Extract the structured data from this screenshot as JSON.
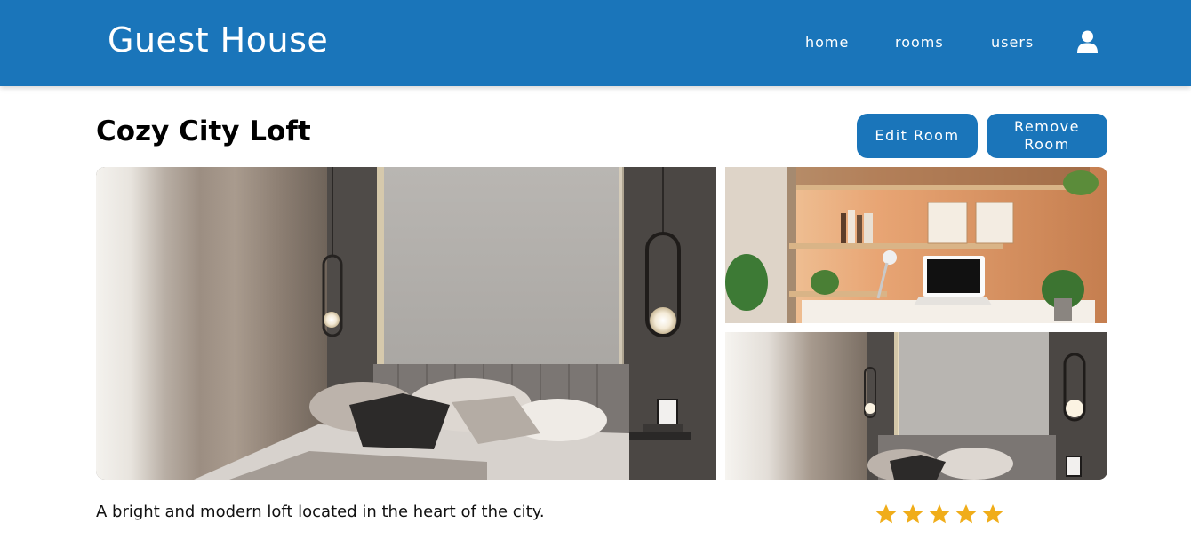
{
  "header": {
    "brand": "Guest House",
    "nav": [
      {
        "label": "home"
      },
      {
        "label": "rooms"
      },
      {
        "label": "users"
      }
    ],
    "user_icon": "user-icon"
  },
  "room": {
    "title": "Cozy City Loft",
    "edit_label": "Edit Room",
    "remove_label": "Remove Room",
    "description": "A bright and modern loft located in the heart of the city.",
    "rating": 5,
    "rating_max": 5
  },
  "photos": [
    {
      "subject": "bedroom-with-pendant-lamps"
    },
    {
      "subject": "desk-with-laptop-and-shelves"
    },
    {
      "subject": "bedroom-with-pendant-lamps"
    }
  ],
  "colors": {
    "primary": "#1a75ba",
    "star": "#f0ad1a",
    "text": "#111111"
  }
}
